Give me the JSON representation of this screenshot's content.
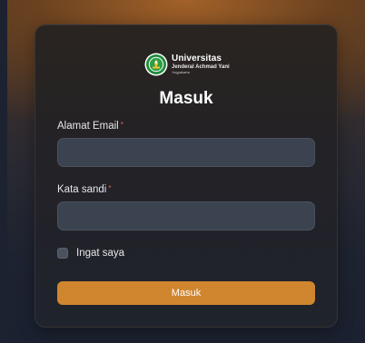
{
  "logo": {
    "line1": "Universitas",
    "line2": "Jenderal Achmad Yani",
    "line3": "Yogyakarta",
    "icon": "university-emblem-icon"
  },
  "form": {
    "title": "Masuk",
    "email": {
      "label": "Alamat Email",
      "required_mark": "*",
      "value": "",
      "placeholder": ""
    },
    "password": {
      "label": "Kata sandi",
      "required_mark": "*",
      "value": "",
      "placeholder": ""
    },
    "remember": {
      "label": "Ingat saya",
      "checked": false
    },
    "submit_label": "Masuk"
  },
  "colors": {
    "accent": "#d0862f",
    "required": "#e0664a",
    "input_bg": "#3b4350"
  }
}
